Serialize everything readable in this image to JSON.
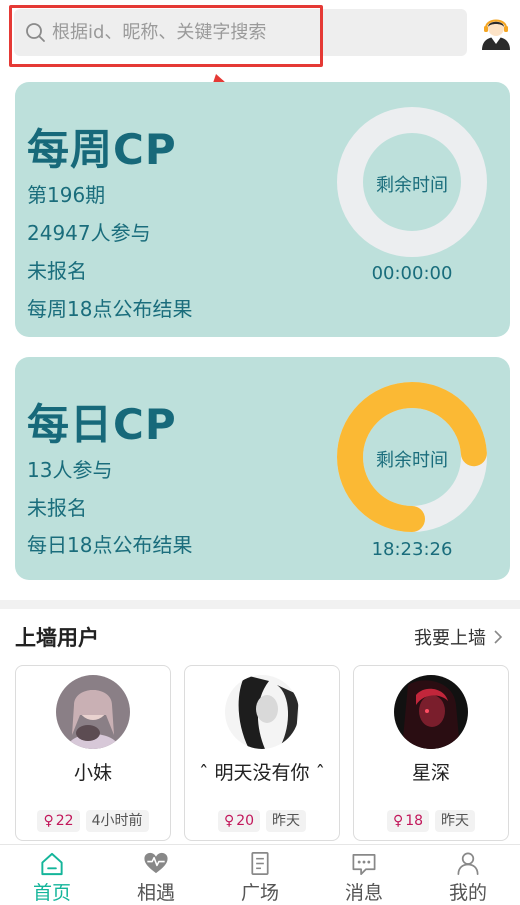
{
  "search": {
    "placeholder": "根据id、昵称、关键字搜索"
  },
  "weekly": {
    "title": "每周CP",
    "issue": "第196期",
    "participants": "24947人参与",
    "status": "未报名",
    "publish": "每周18点公布结果",
    "ring_label": "剩余时间",
    "countdown": "00:00:00",
    "progress": 0
  },
  "daily": {
    "title": "每日CP",
    "participants": "13人参与",
    "status": "未报名",
    "publish": "每日18点公布结果",
    "ring_label": "剩余时间",
    "countdown": "18:23:26",
    "progress": 0.74
  },
  "wall": {
    "title": "上墙用户",
    "link": "我要上墙",
    "users": [
      {
        "name": "小妹",
        "gender": "♀",
        "age": "22",
        "time": "4小时前"
      },
      {
        "name": "ˆ 明天没有你 ˆ",
        "gender": "♀",
        "age": "20",
        "time": "昨天"
      },
      {
        "name": "星深",
        "gender": "♀",
        "age": "18",
        "time": "昨天"
      }
    ]
  },
  "nav": [
    {
      "label": "首页",
      "icon": "home-icon",
      "active": true
    },
    {
      "label": "相遇",
      "icon": "heart-pulse-icon",
      "active": false
    },
    {
      "label": "广场",
      "icon": "document-icon",
      "active": false
    },
    {
      "label": "消息",
      "icon": "chat-icon",
      "active": false
    },
    {
      "label": "我的",
      "icon": "person-icon",
      "active": false
    }
  ],
  "colors": {
    "card_bg": "#bde0db",
    "card_text": "#17697a",
    "ring_track": "#eceef0",
    "ring_progress": "#fbb934",
    "accent": "#14b59a",
    "annotation": "#e53935"
  }
}
